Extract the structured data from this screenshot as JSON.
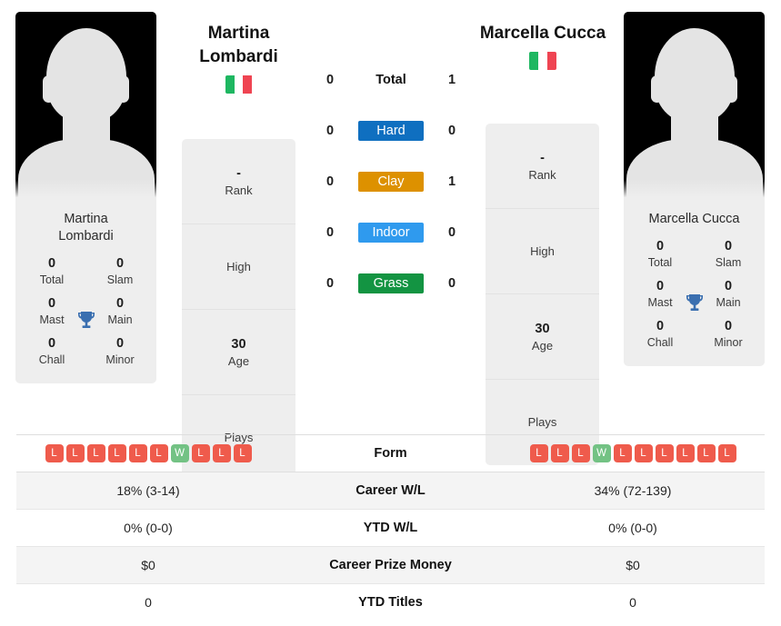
{
  "players": {
    "left": {
      "heading_line1": "Martina",
      "heading_line2": "Lombardi",
      "flag": "italy-flag",
      "photo_caption_line1": "Martina",
      "photo_caption_line2": "Lombardi",
      "titles": {
        "total_value": "0",
        "total_label": "Total",
        "slam_value": "0",
        "slam_label": "Slam",
        "mast_value": "0",
        "mast_label": "Mast",
        "main_value": "0",
        "main_label": "Main",
        "chall_value": "0",
        "chall_label": "Chall",
        "minor_value": "0",
        "minor_label": "Minor",
        "icon": "trophy-icon"
      },
      "info": {
        "rank_value": "-",
        "rank_label": "Rank",
        "high_value": "",
        "high_label": "High",
        "age_value": "30",
        "age_label": "Age",
        "plays_value": "",
        "plays_label": "Plays"
      }
    },
    "right": {
      "heading_line1": "Marcella Cucca",
      "heading_line2": "",
      "flag": "italy-flag",
      "photo_caption_line1": "Marcella Cucca",
      "photo_caption_line2": "",
      "titles": {
        "total_value": "0",
        "total_label": "Total",
        "slam_value": "0",
        "slam_label": "Slam",
        "mast_value": "0",
        "mast_label": "Mast",
        "main_value": "0",
        "main_label": "Main",
        "chall_value": "0",
        "chall_label": "Chall",
        "minor_value": "0",
        "minor_label": "Minor",
        "icon": "trophy-icon"
      },
      "info": {
        "rank_value": "-",
        "rank_label": "Rank",
        "high_value": "",
        "high_label": "High",
        "age_value": "30",
        "age_label": "Age",
        "plays_value": "",
        "plays_label": "Plays"
      }
    }
  },
  "h2h": {
    "rows": [
      {
        "left": "0",
        "label": "Total",
        "right": "1",
        "style": "plain",
        "color": ""
      },
      {
        "left": "0",
        "label": "Hard",
        "right": "0",
        "style": "chip",
        "color": "#0f6fc0"
      },
      {
        "left": "0",
        "label": "Clay",
        "right": "1",
        "style": "chip",
        "color": "#dd9100"
      },
      {
        "left": "0",
        "label": "Indoor",
        "right": "0",
        "style": "chip",
        "color": "#2f9aee"
      },
      {
        "left": "0",
        "label": "Grass",
        "right": "0",
        "style": "chip",
        "color": "#139442"
      }
    ]
  },
  "comparison": {
    "form_label": "Form",
    "left_form": [
      "L",
      "L",
      "L",
      "L",
      "L",
      "L",
      "W",
      "L",
      "L",
      "L"
    ],
    "right_form": [
      "L",
      "L",
      "L",
      "W",
      "L",
      "L",
      "L",
      "L",
      "L",
      "L"
    ],
    "rows": [
      {
        "label": "Career W/L",
        "left": "18% (3-14)",
        "right": "34% (72-139)"
      },
      {
        "label": "YTD W/L",
        "left": "0% (0-0)",
        "right": "0% (0-0)"
      },
      {
        "label": "Career Prize Money",
        "left": "$0",
        "right": "$0"
      },
      {
        "label": "YTD Titles",
        "left": "0",
        "right": "0"
      }
    ]
  }
}
